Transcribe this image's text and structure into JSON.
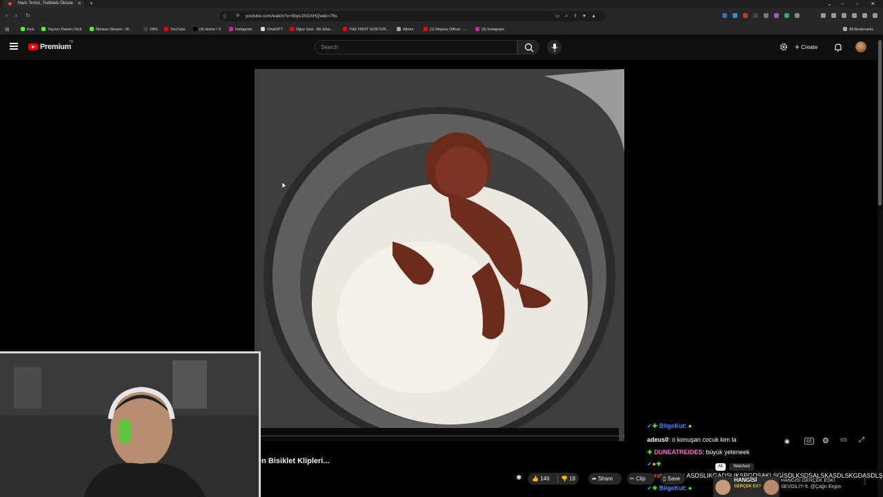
{
  "browser": {
    "tab_title": "Martı Terörü, Trafikteki Öküzle",
    "url": "youtube.com/watch?v=5bys3XGXHQw&t=76s",
    "bookmarks": [
      "Kick",
      "Yayıncı Paneli | Kick",
      "İlkinsan Stream - W...",
      "OBS",
      "YouTube",
      "(4) Home / X",
      "Instagram",
      "ChatGPT",
      "Oğuz Sasi - Bir Efsa...",
      "THE FIRST GOKTUR...",
      "Albüm",
      "(1) Mepraz Offical - ...",
      "(9) Instagram"
    ],
    "all_bookmarks": "All Bookmarks"
  },
  "youtube": {
    "logo": "Premium",
    "logo_sup": "TR",
    "search_placeholder": "Search",
    "create_label": "Create",
    "video_title": "en Bisiklet Klipleri...",
    "likes": "146",
    "dislikes": "18",
    "share": "Share",
    "clip": "Clip",
    "save": "Save",
    "chips": [
      "All",
      "Watched"
    ],
    "endscreen_title": "HANGİSİ GERÇEK ESKİ SEVGİLİ?! ft. @Çağrı Ergün",
    "endscreen_line1": "HANGİSİ GERÇEK ESKİ",
    "endscreen_line2": "SEVGİLİ?! ft. @Çağrı Ergün",
    "thumb_text": "HANGİSİ",
    "thumb_text2": "GERÇEK EX?"
  },
  "chat": [
    {
      "user": "BilgeKut",
      "text": ""
    },
    {
      "user": "adeus0",
      "text": "o konuşan cocuk kim la"
    },
    {
      "user": "DUNEATREIDES",
      "text": "büyük yeteneek"
    },
    {
      "user": "",
      "text": ""
    },
    {
      "user": "beratsimsek",
      "text": "ASDSLIKGADSLIKSPGDSAKLSGİSDLKSDSALSKASDLSKGDASDLŞK"
    },
    {
      "user": "BilgeKut",
      "text": ""
    }
  ],
  "colors": {
    "brand_red": "#ff0000",
    "background": "#0f0f0f",
    "chat_user_blue": "#3d8dff",
    "chat_user_pink": "#ff6fd0"
  }
}
